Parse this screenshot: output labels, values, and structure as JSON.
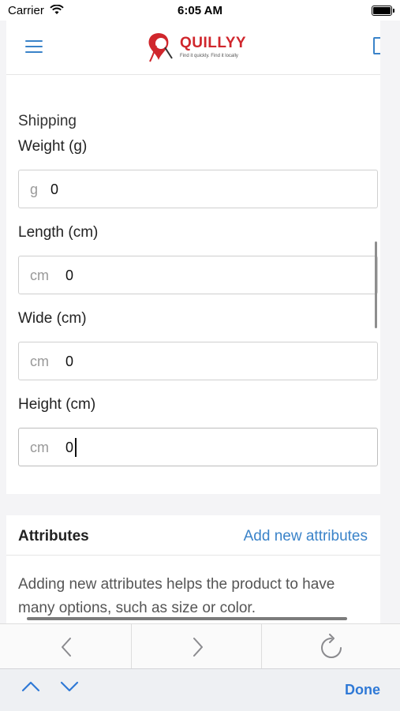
{
  "status_bar": {
    "carrier": "Carrier",
    "time": "6:05 AM"
  },
  "header": {
    "logo_text": "QUILLYY",
    "logo_tagline": "Find it quickly. Find it locally"
  },
  "shipping": {
    "section_title": "Shipping",
    "fields": [
      {
        "label": "Weight (g)",
        "unit": "g",
        "value": "0"
      },
      {
        "label": "Length (cm)",
        "unit": "cm",
        "value": "0"
      },
      {
        "label": "Wide (cm)",
        "unit": "cm",
        "value": "0"
      },
      {
        "label": "Height (cm)",
        "unit": "cm",
        "value": "0"
      }
    ]
  },
  "attributes": {
    "title": "Attributes",
    "add_link": "Add new attributes",
    "description": "Adding new attributes helps the product to have many options, such as size or color."
  },
  "keyboard_bar": {
    "done_label": "Done"
  },
  "colors": {
    "accent": "#3a83c9",
    "brand": "#d0262c"
  }
}
